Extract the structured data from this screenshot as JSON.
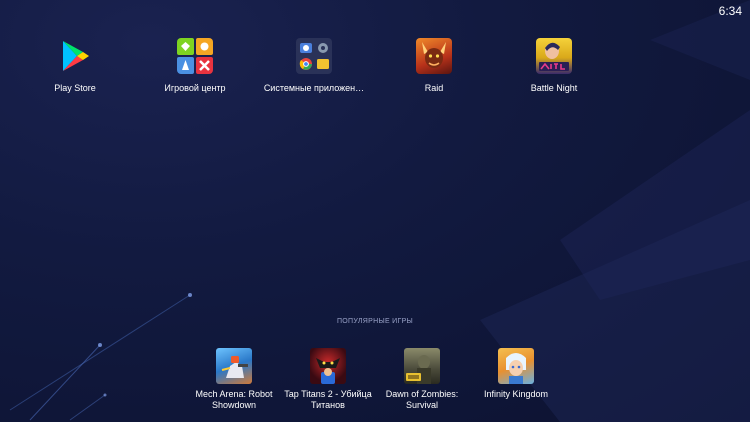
{
  "status_bar": {
    "time": "6:34"
  },
  "apps": [
    {
      "label": "Play Store",
      "icon": "play-store-icon"
    },
    {
      "label": "Игровой центр",
      "icon": "game-center-icon"
    },
    {
      "label": "Системные приложен…",
      "icon": "system-apps-folder-icon"
    },
    {
      "label": "Raid",
      "icon": "raid-icon"
    },
    {
      "label": "Battle Night",
      "icon": "battle-night-icon"
    }
  ],
  "popular": {
    "title": "ПОПУЛЯРНЫЕ ИГРЫ",
    "games": [
      {
        "label": "Mech Arena: Robot Showdown",
        "icon": "mech-arena-icon"
      },
      {
        "label": "Tap Titans 2 - Убийца Титанов",
        "icon": "tap-titans-icon"
      },
      {
        "label": "Dawn of Zombies: Survival",
        "icon": "dawn-of-zombies-icon"
      },
      {
        "label": "Infinity Kingdom",
        "icon": "infinity-kingdom-icon"
      }
    ]
  }
}
